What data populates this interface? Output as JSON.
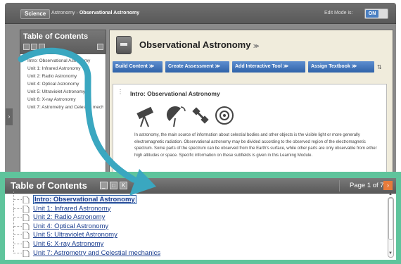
{
  "app": {
    "subject_button": "Science",
    "breadcrumb": [
      "Astronomy",
      "Observational Astronomy"
    ],
    "edit_mode_label": "Edit Mode is:",
    "edit_mode_value": "ON"
  },
  "toc_panel": {
    "title": "Table of Contents",
    "items": [
      "Intro: Observational Astronomy",
      "Unit 1: Infrared Astronomy",
      "Unit 2: Radio Astronomy",
      "Unit 4: Optical Astronomy",
      "Unit 5: Ultraviolet Astronomy",
      "Unit 6: X-ray Astronomy",
      "Unit 7: Astrometry and Celestial mechanics"
    ]
  },
  "content": {
    "title": "Observational Astronomy",
    "toolbar": [
      "Build Content",
      "Create Assessment",
      "Add Interactive Tool",
      "Assign Textbook"
    ],
    "section_title": "Intro: Observational Astronomy",
    "paragraph": "In astronomy, the main source of information about celestial bodies and other objects is the visible light or more generally electromagnetic radiation. Observational astronomy may be divided according to the observed region of the electromagnetic spectrum. Some parts of the spectrum can be observed from the Earth's surface, while other parts are only observable from either high altitudes or space. Specific information on these subfields is given in this Learning Module.",
    "icons": [
      "telescope-icon",
      "satellite-dish-icon",
      "satellite-icon",
      "target-icon"
    ]
  },
  "zoom": {
    "title": "Table of Contents",
    "page_indicator": "Page 1 of 7",
    "selected_index": 0,
    "items": [
      "Intro: Observational Astronomy",
      "Unit 1: Infrared Astronomy",
      "Unit 2: Radio Astronomy",
      "Unit 4: Optical Astronomy",
      "Unit 5: Ultraviolet Astronomy",
      "Unit 6: X-ray Astronomy",
      "Unit 7: Astrometry and Celestial mechanics"
    ]
  },
  "colors": {
    "zoom_border": "#5fc49c",
    "callout_arrow": "#3aa7c0",
    "toolbar_blue": "#2f62a8",
    "next_button": "#e77b3b"
  }
}
